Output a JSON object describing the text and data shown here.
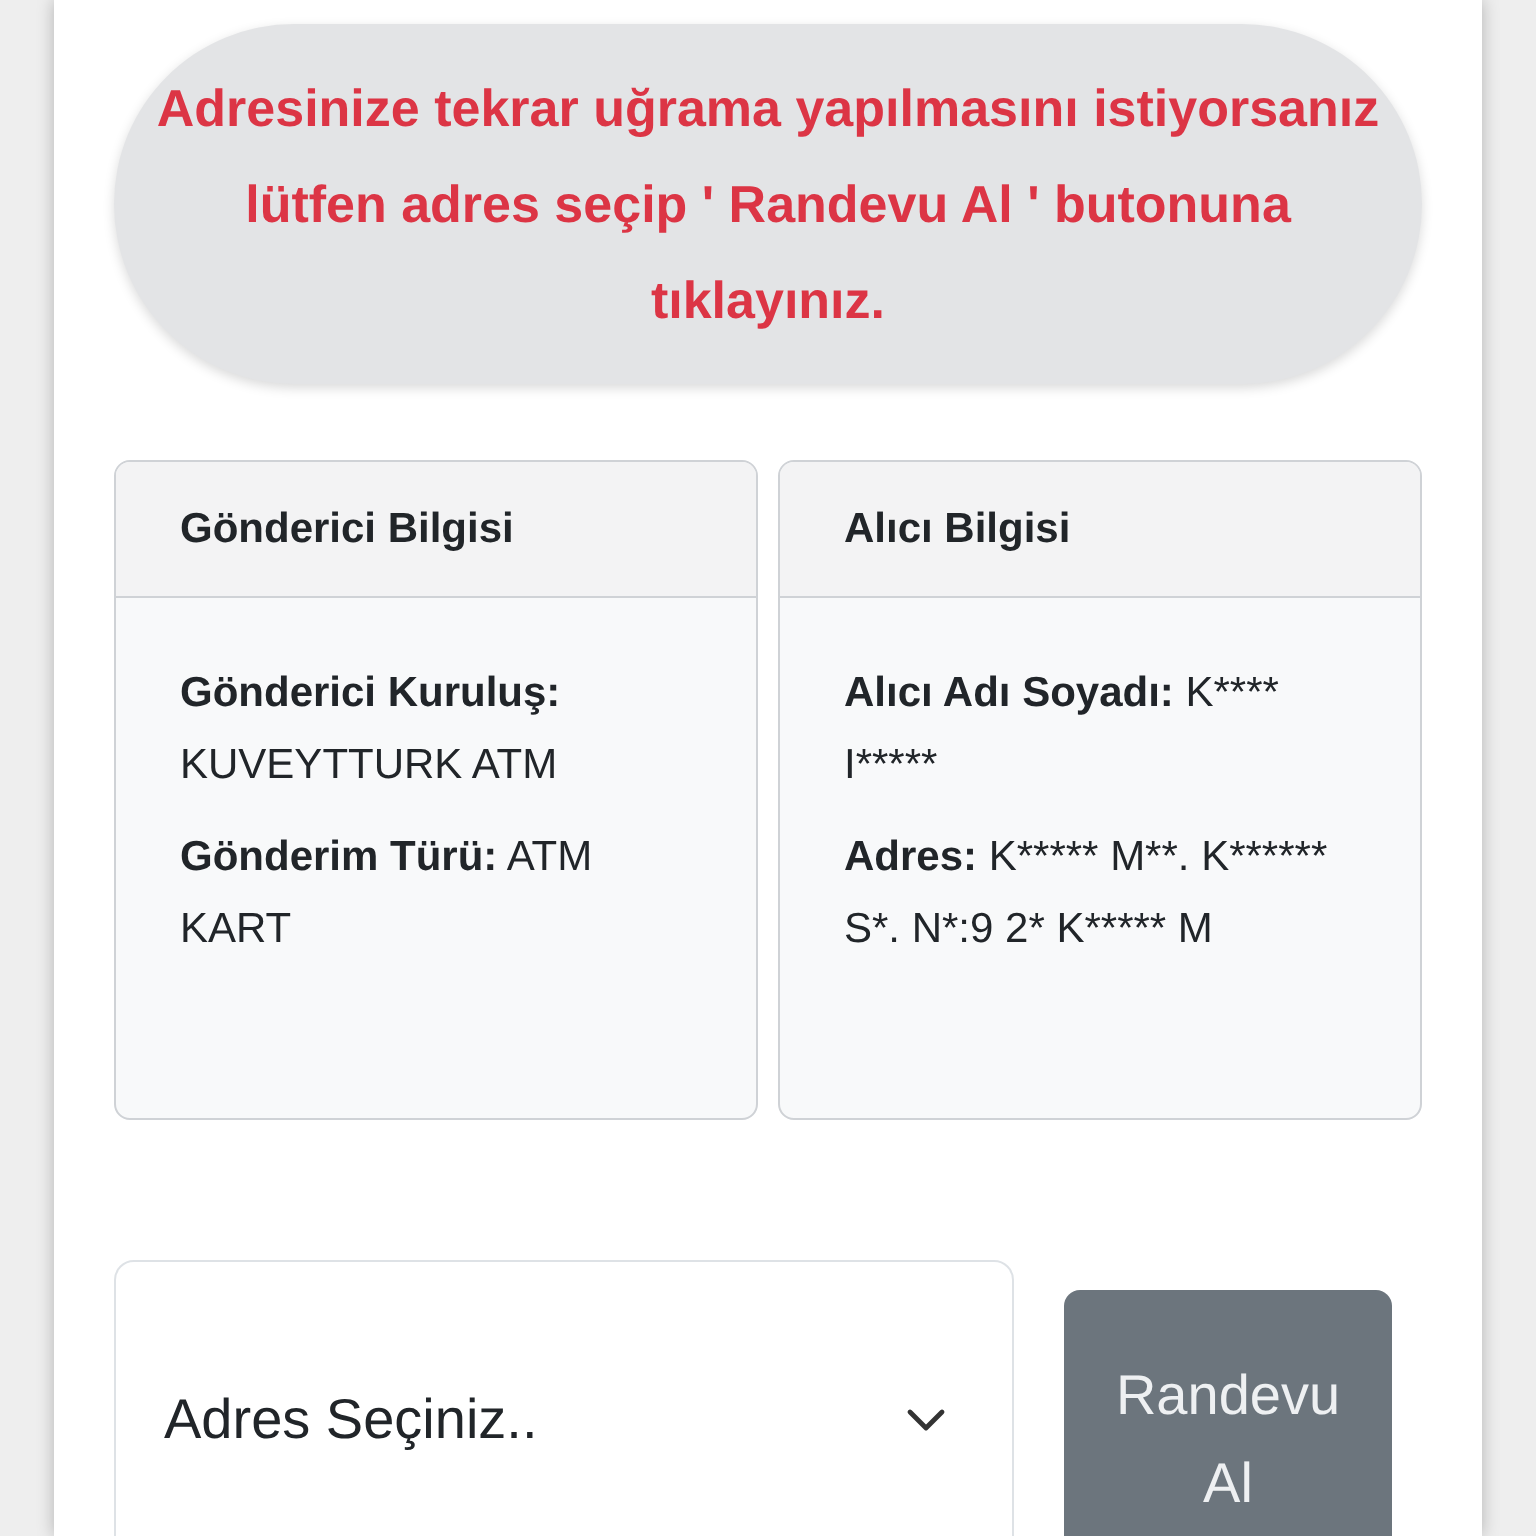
{
  "notice": "Adresinize tekrar uğrama yapılmasını istiyorsanız lütfen adres seçip ' Randevu Al ' butonuna tıklayınız.",
  "cards": [
    {
      "title": "Gönderici Bilgisi",
      "fields": [
        {
          "label": "Gönderici Kuruluş:",
          "value": "KUVEYTTURK ATM"
        },
        {
          "label": "Gönderim Türü:",
          "value": "ATM KART"
        }
      ]
    },
    {
      "title": "Alıcı Bilgisi",
      "fields": [
        {
          "label": "Alıcı Adı Soyadı:",
          "value": "K**** I*****"
        },
        {
          "label": "Adres:",
          "value": "K***** M**. K****** S*. N*:9 2* K***** M"
        }
      ]
    }
  ],
  "address_select": {
    "placeholder": "Adres Seçiniz.."
  },
  "button": {
    "label": "Randevu Al",
    "disabled": true
  }
}
